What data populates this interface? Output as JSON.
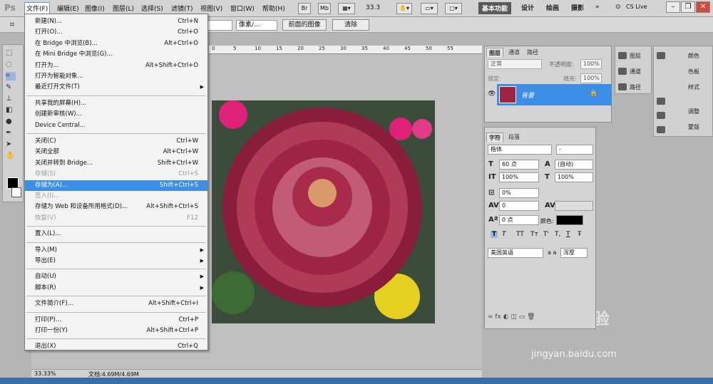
{
  "app": {
    "logo": "Ps"
  },
  "menubar": {
    "items": [
      "文件(F)",
      "编辑(E)",
      "图像(I)",
      "图层(L)",
      "选择(S)",
      "滤镜(T)",
      "视图(V)",
      "窗口(W)",
      "帮助(H)"
    ],
    "bridge_btn": "Br",
    "minibridge_btn": "Mb",
    "zoom": "33.3",
    "workspaces": [
      "基本功能",
      "设计",
      "绘画",
      "摄影"
    ],
    "cslive": "CS Live"
  },
  "optbar": {
    "unit": "像素/...",
    "front_image": "前面的图像",
    "clear": "清除"
  },
  "ruler": {
    "ticks": [
      "0",
      "5",
      "10",
      "15",
      "20",
      "25",
      "30",
      "35",
      "40",
      "45",
      "50",
      "55"
    ]
  },
  "file_menu": {
    "items": [
      {
        "label": "新建(N)...",
        "shortcut": "Ctrl+N",
        "state": "normal"
      },
      {
        "label": "打开(O)...",
        "shortcut": "Ctrl+O",
        "state": "normal"
      },
      {
        "label": "在 Bridge 中浏览(B)...",
        "shortcut": "Alt+Ctrl+O",
        "state": "normal"
      },
      {
        "label": "在 Mini Bridge 中浏览(G)...",
        "shortcut": "",
        "state": "normal"
      },
      {
        "label": "打开为...",
        "shortcut": "Alt+Shift+Ctrl+O",
        "state": "normal"
      },
      {
        "label": "打开为智能对象...",
        "shortcut": "",
        "state": "normal"
      },
      {
        "label": "最近打开文件(T)",
        "shortcut": "",
        "state": "submenu"
      },
      {
        "sep": true
      },
      {
        "label": "共享我的屏幕(H)...",
        "shortcut": "",
        "state": "normal"
      },
      {
        "label": "创建新审核(W)...",
        "shortcut": "",
        "state": "normal"
      },
      {
        "label": "Device Central...",
        "shortcut": "",
        "state": "normal"
      },
      {
        "sep": true
      },
      {
        "label": "关闭(C)",
        "shortcut": "Ctrl+W",
        "state": "normal"
      },
      {
        "label": "关闭全部",
        "shortcut": "Alt+Ctrl+W",
        "state": "normal"
      },
      {
        "label": "关闭并转到 Bridge...",
        "shortcut": "Shift+Ctrl+W",
        "state": "normal"
      },
      {
        "label": "存储(S)",
        "shortcut": "Ctrl+S",
        "state": "disabled"
      },
      {
        "label": "存储为(A)...",
        "shortcut": "Shift+Ctrl+S",
        "state": "highlight"
      },
      {
        "label": "签入(I)...",
        "shortcut": "",
        "state": "disabled"
      },
      {
        "label": "存储为 Web 和设备所用格式(D)...",
        "shortcut": "Alt+Shift+Ctrl+S",
        "state": "normal"
      },
      {
        "label": "恢复(V)",
        "shortcut": "F12",
        "state": "disabled"
      },
      {
        "sep": true
      },
      {
        "label": "置入(L)...",
        "shortcut": "",
        "state": "normal"
      },
      {
        "sep": true
      },
      {
        "label": "导入(M)",
        "shortcut": "",
        "state": "submenu"
      },
      {
        "label": "导出(E)",
        "shortcut": "",
        "state": "submenu"
      },
      {
        "sep": true
      },
      {
        "label": "自动(U)",
        "shortcut": "",
        "state": "submenu"
      },
      {
        "label": "脚本(R)",
        "shortcut": "",
        "state": "submenu"
      },
      {
        "sep": true
      },
      {
        "label": "文件简介(F)...",
        "shortcut": "Alt+Shift+Ctrl+I",
        "state": "normal"
      },
      {
        "sep": true
      },
      {
        "label": "打印(P)...",
        "shortcut": "Ctrl+P",
        "state": "normal"
      },
      {
        "label": "打印一份(Y)",
        "shortcut": "Alt+Shift+Ctrl+P",
        "state": "normal"
      },
      {
        "sep": true
      },
      {
        "label": "退出(X)",
        "shortcut": "Ctrl+Q",
        "state": "normal"
      }
    ]
  },
  "layers_panel": {
    "tabs": [
      "图层",
      "通道",
      "路径"
    ],
    "blend_mode": "正常",
    "opacity_label": "不透明度:",
    "opacity_value": "100%",
    "lock_label": "锁定:",
    "fill_label": "填充:",
    "fill_value": "100%",
    "layer_name": "背景"
  },
  "char_panel": {
    "tabs": [
      "字符",
      "段落"
    ],
    "font_family": "楷体",
    "font_style": "-",
    "font_size": "60 点",
    "leading": "(自动)",
    "vscale": "100%",
    "hscale": "100%",
    "baseline_scale": "0%",
    "tracking": "0",
    "baseline_shift": "0 点",
    "color_label": "颜色:",
    "language": "美国英语",
    "aa_label": "a a",
    "aa_value": "浑厚",
    "format_buttons": [
      "T",
      "T",
      "TT",
      "Tт",
      "T'",
      "T,",
      "T",
      "Ŧ"
    ]
  },
  "dock": {
    "col1": [
      "图层",
      "通道",
      "路径"
    ],
    "col2": [
      "颜色",
      "色板",
      "样式",
      "调整",
      "蒙版"
    ]
  },
  "status": {
    "zoom": "33.33%",
    "doc": "文档:4.69M/4.69M"
  },
  "watermark": {
    "text": "Baidu经验",
    "url": "jingyan.baidu.com"
  },
  "colors": {
    "accent": "#3d8ee6",
    "menu_bg": "#f3f3f3",
    "chrome": "#d4d4d4"
  }
}
